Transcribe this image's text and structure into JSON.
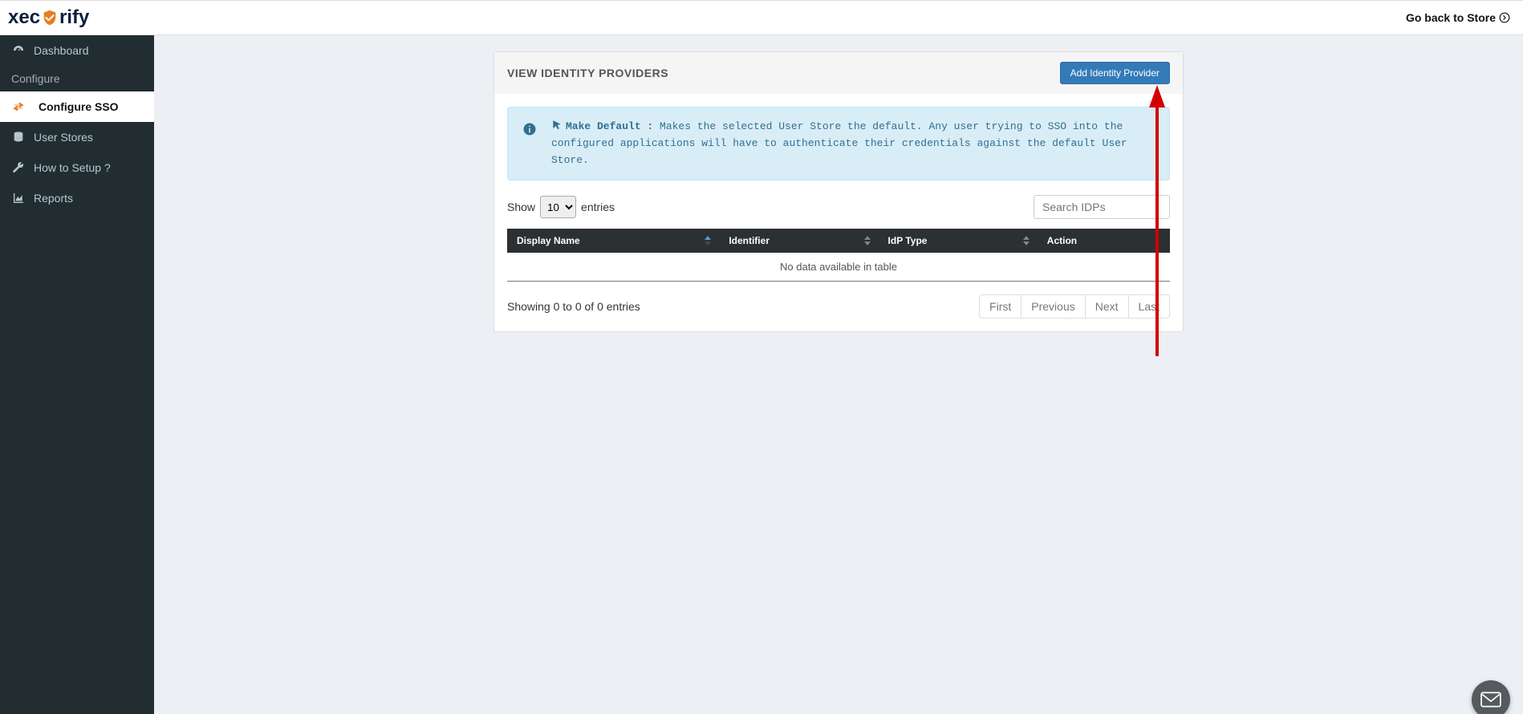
{
  "header": {
    "logo_left": "xec",
    "logo_right": "rify",
    "go_back_label": "Go back to Store"
  },
  "sidebar": {
    "items": [
      {
        "label": "Dashboard"
      },
      {
        "label": "Configure"
      },
      {
        "label": "Configure SSO"
      },
      {
        "label": "User Stores"
      },
      {
        "label": "How to Setup ?"
      },
      {
        "label": "Reports"
      }
    ]
  },
  "panel": {
    "title": "VIEW IDENTITY PROVIDERS",
    "add_button": "Add Identity Provider"
  },
  "alert": {
    "lead": "Make Default :",
    "text": " Makes the selected User Store the default. Any user trying to SSO into the configured applications will have to authenticate their credentials against the default User Store."
  },
  "table": {
    "show_prefix": "Show",
    "show_suffix": "entries",
    "length_value": "10",
    "search_placeholder": "Search IDPs",
    "columns": {
      "display_name": "Display Name",
      "identifier": "Identifier",
      "idp_type": "IdP Type",
      "action": "Action"
    },
    "empty_text": "No data available in table",
    "info_text": "Showing 0 to 0 of 0 entries",
    "pagination": {
      "first": "First",
      "previous": "Previous",
      "next": "Next",
      "last": "Last"
    }
  }
}
